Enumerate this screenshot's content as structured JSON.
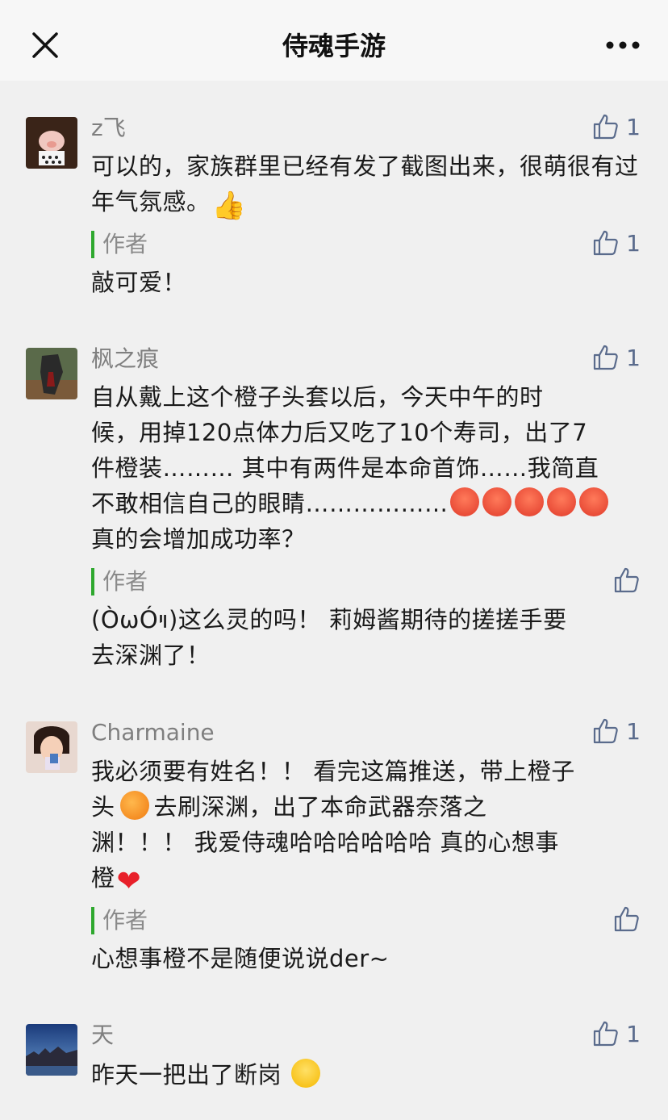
{
  "header": {
    "title": "侍魂手游",
    "close_icon": "close-icon",
    "more_icon": "more-icon"
  },
  "comments": [
    {
      "nickname": "z飞",
      "content": "可以的，家族群里已经有发了截图出来，很萌很有过年气氛感。",
      "emoji_after": "👍",
      "likes": "1",
      "reply": {
        "tag": "作者",
        "content": "敲可爱！",
        "likes": "1"
      }
    },
    {
      "nickname": "枫之痕",
      "content_line1": "自从戴上这个橙子头套以后，今天中午的时",
      "content_line2": "候，用掉120点体力后又吃了10个寿司，出了7",
      "content_line3": "件橙装……… 其中有两件是本命首饰……我简直",
      "content_line4": "不敢相信自己的眼睛………………",
      "content_line5": "真的会增加成功率？",
      "likes": "1",
      "reply": {
        "tag": "作者",
        "content_line1": "(ÒωÓױ)这么灵的吗！ 莉姆酱期待的搓搓手要",
        "content_line2": "去深渊了！",
        "likes": ""
      }
    },
    {
      "nickname": "Charmaine",
      "content_line1": "我必须要有姓名！！ 看完这篇推送，带上橙子",
      "content_line2a": "头",
      "content_line2b": "去刷深渊，出了本命武器奈落之",
      "content_line3": "渊！！！ 我爱侍魂哈哈哈哈哈哈 真的心想事",
      "content_line4": "橙",
      "likes": "1",
      "reply": {
        "tag": "作者",
        "content": "心想事橙不是随便说说der~",
        "likes": ""
      }
    },
    {
      "nickname": "天",
      "content": "昨天一把出了断岗",
      "likes": "1"
    }
  ],
  "colors": {
    "accent_green": "#2ea82e",
    "like_blue": "#5a6b8c",
    "background": "#f0f0f0"
  }
}
